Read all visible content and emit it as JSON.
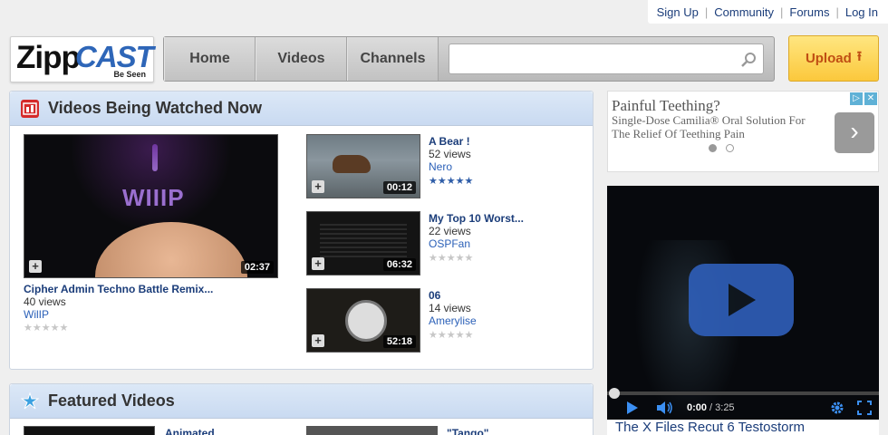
{
  "toplinks": [
    "Sign Up",
    "Community",
    "Forums",
    "Log In"
  ],
  "logo": {
    "zip": "Zipp",
    "cast": "CAST",
    "tagline": "Be Seen"
  },
  "nav": [
    "Home",
    "Videos",
    "Channels"
  ],
  "search": {
    "value": "",
    "placeholder": ""
  },
  "upload": {
    "label": "Upload"
  },
  "watching": {
    "title": "Videos Being Watched Now",
    "main": {
      "title": "Cipher Admin Techno Battle Remix...",
      "views": "40 views",
      "user": "WilIP",
      "duration": "02:37",
      "thumb_text": "WIIIP",
      "stars": 0
    },
    "side": [
      {
        "title": "A Bear !",
        "views": "52 views",
        "user": "Nero",
        "duration": "00:12",
        "stars": 5
      },
      {
        "title": "My Top 10 Worst...",
        "views": "22 views",
        "user": "OSPFan",
        "duration": "06:32",
        "stars": 0
      },
      {
        "title": "06",
        "views": "14 views",
        "user": "Amerylise",
        "duration": "52:18",
        "stars": 0
      }
    ]
  },
  "featured": {
    "title": "Featured Videos",
    "items": [
      {
        "title": "Animated"
      },
      {
        "title": "\"Tango\""
      }
    ]
  },
  "ad": {
    "headline": "Painful Teething?",
    "body": "Single-Dose Camilia® Oral Solution For The Relief Of Teething Pain"
  },
  "player": {
    "time": "0:00",
    "duration": "/ 3:25",
    "title": "The X Files Recut 6 Testostorm"
  },
  "colors": {
    "link": "#1b3d7a",
    "accent": "#2f5da8",
    "upload": "#fbc83c"
  }
}
